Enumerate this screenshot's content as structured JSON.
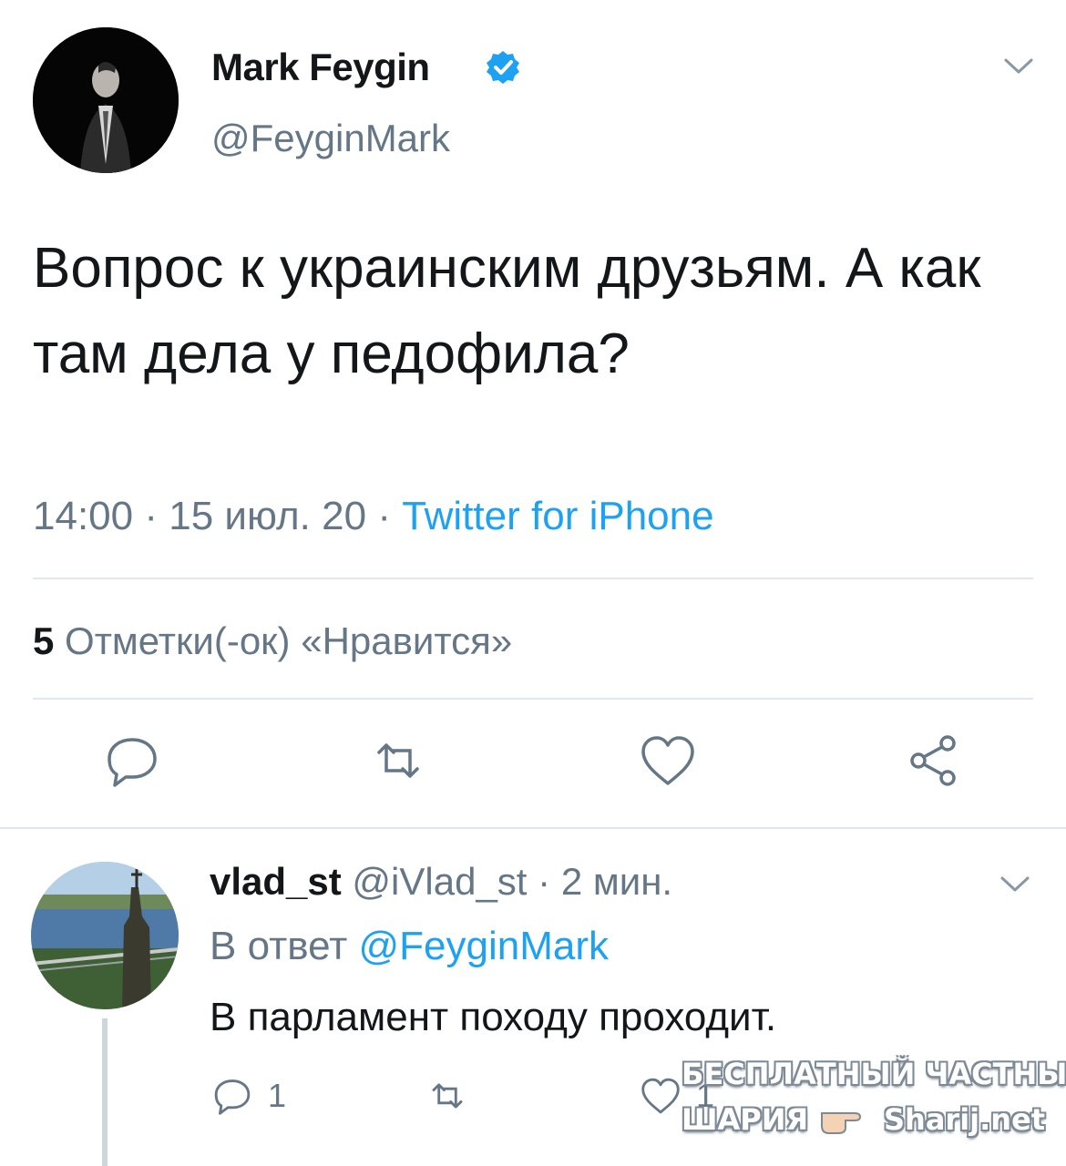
{
  "tweet": {
    "author_name": "Mark Feygin",
    "handle": "@FeyginMark",
    "verified": true,
    "text": "Вопрос к украинским друзьям. А как там дела у педофила?",
    "time": "14:00",
    "date": "15 июл. 20",
    "separator": "·",
    "source": "Twitter for iPhone",
    "likes_count": "5",
    "likes_label": "Отметки(-ок) «Нравится»"
  },
  "actions": {
    "reply_icon": "reply-icon",
    "retweet_icon": "retweet-icon",
    "like_icon": "like-icon",
    "share_icon": "share-icon"
  },
  "reply": {
    "author_name": "vlad_st",
    "handle": "@iVlad_st",
    "time_ago": "2 мин.",
    "reply_prefix": "В ответ",
    "reply_to": "@FeyginMark",
    "text": "В парламент походу проходит.",
    "reply_count": "1",
    "like_count": "1"
  },
  "watermark": {
    "line1": "БЕСПЛАТНЫЙ ЧАСТНЫЙ",
    "line2": "ШАРИЯ",
    "line3": "Sharij.net"
  },
  "colors": {
    "text": "#14171a",
    "secondary": "#657786",
    "accent": "#1da1f2",
    "divider": "#e1e8ed"
  }
}
